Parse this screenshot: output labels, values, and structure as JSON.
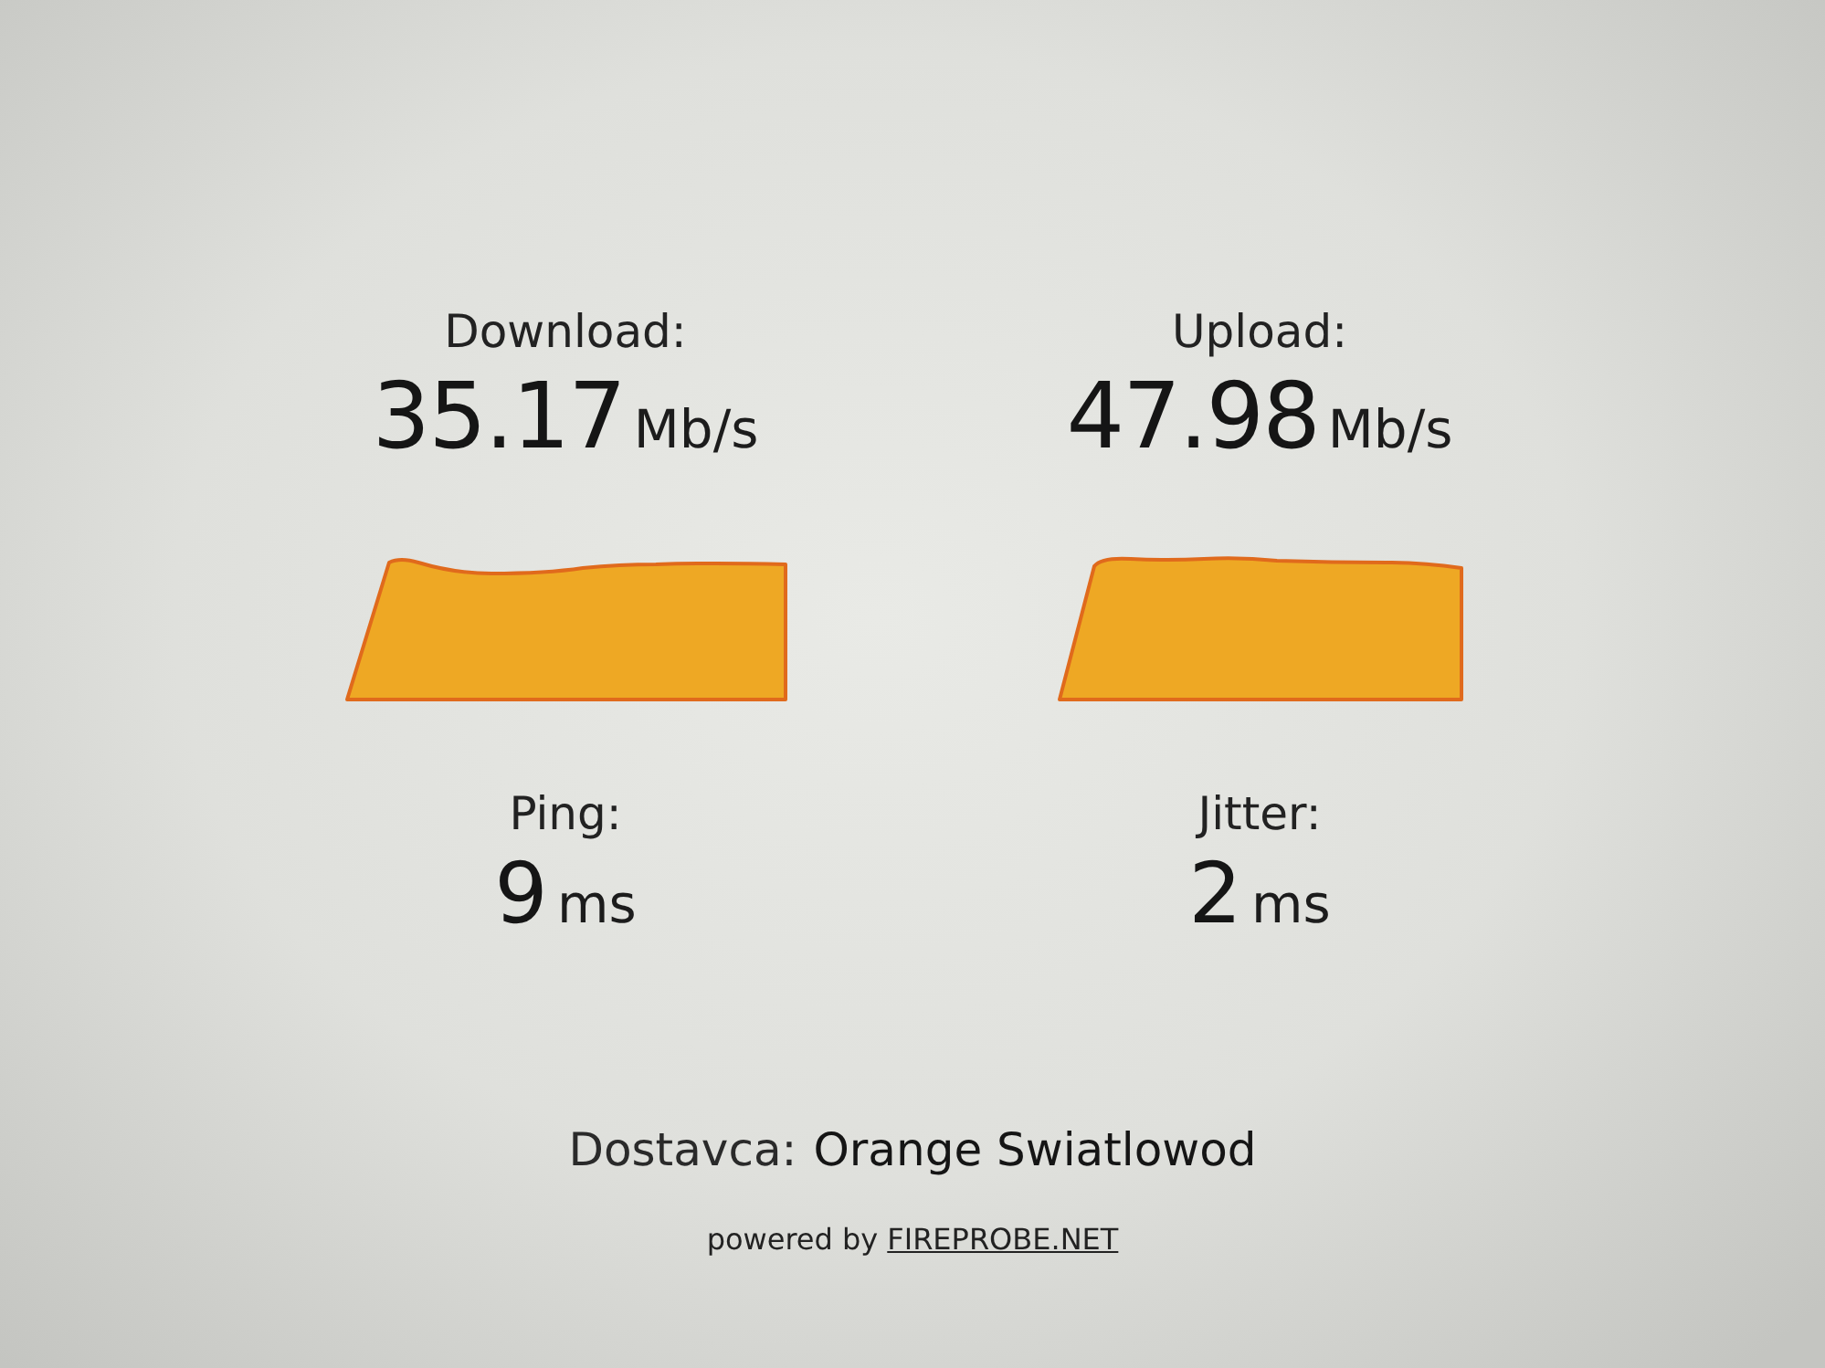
{
  "speeds": [
    {
      "label": "Download:",
      "value": "35.17",
      "unit": "Mb/s"
    },
    {
      "label": "Upload:",
      "value": "47.98",
      "unit": "Mb/s"
    }
  ],
  "latency": [
    {
      "label": "Ping:",
      "value": "9",
      "unit": "ms"
    },
    {
      "label": "Jitter:",
      "value": "2",
      "unit": "ms"
    }
  ],
  "provider": {
    "label": "Dostavca:",
    "name": "Orange Swiatlowod"
  },
  "footer": {
    "text": "powered by",
    "link": "FIREPROBE.NET"
  }
}
